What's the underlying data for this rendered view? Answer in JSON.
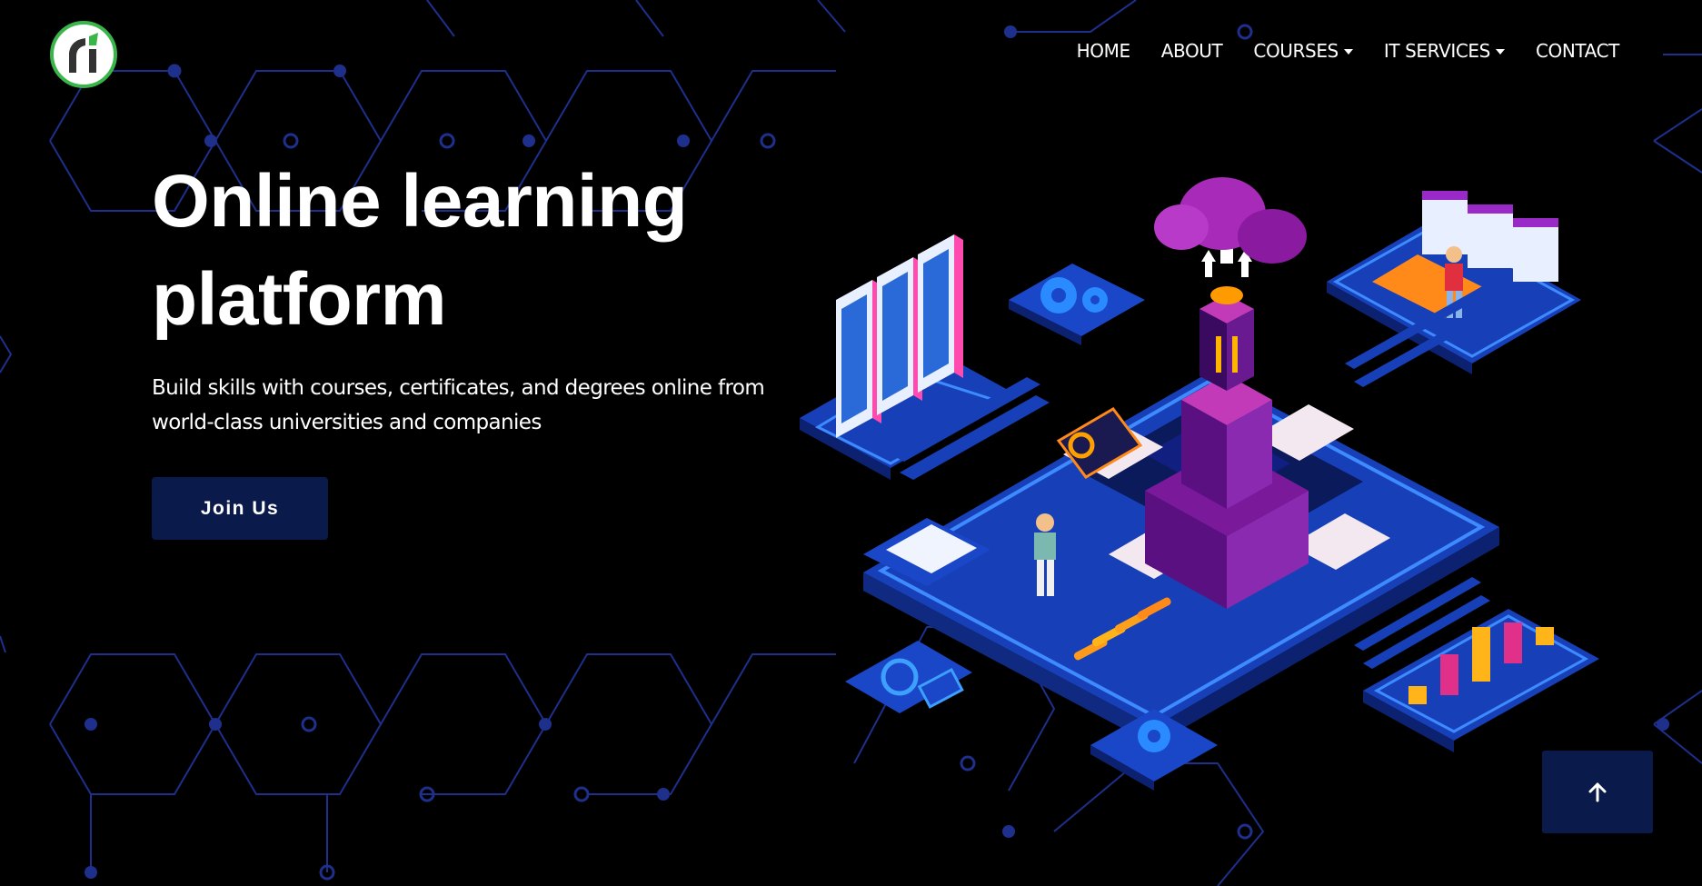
{
  "brand": {
    "logo_icon": "brand-logo-icon",
    "accent_color": "#39b54a"
  },
  "nav": {
    "home": "HOME",
    "about": "ABOUT",
    "courses": "COURSES",
    "it_services": "IT SERVICES",
    "contact": "CONTACT"
  },
  "hero": {
    "title": "Online learning platform",
    "subtitle": "Build skills with courses, certificates, and degrees online from world-class universities and companies",
    "cta_label": "Join Us"
  },
  "back_to_top": {
    "icon": "arrow-up-icon"
  },
  "colors": {
    "background": "#000000",
    "button_bg": "#0a1a4a",
    "hex_line": "#1e2f8c",
    "illustration_primary": "#1a46c8"
  }
}
